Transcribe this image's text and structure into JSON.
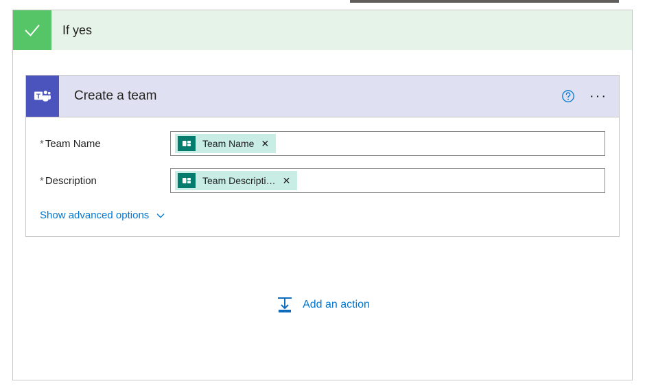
{
  "condition": {
    "branch_label": "If yes"
  },
  "action": {
    "connector": "Microsoft Teams",
    "title": "Create a team",
    "fields": [
      {
        "id": "teamName",
        "label": "Team Name",
        "required": true,
        "token": {
          "source": "Microsoft Forms",
          "icon": "forms-icon",
          "label": "Team Name"
        }
      },
      {
        "id": "description",
        "label": "Description",
        "required": true,
        "token": {
          "source": "Microsoft Forms",
          "icon": "forms-icon",
          "label": "Team Descripti…"
        }
      }
    ],
    "advanced_link": "Show advanced options"
  },
  "footer": {
    "add_action_label": "Add an action"
  },
  "colors": {
    "if_yes_bg": "#e6f3e9",
    "if_yes_icon": "#56c568",
    "teams_purple": "#4b53bc",
    "action_header_bg": "#dfe0f1",
    "link_blue": "#0078d4",
    "forms_teal": "#037c6e",
    "token_bg": "#c8ede5"
  }
}
